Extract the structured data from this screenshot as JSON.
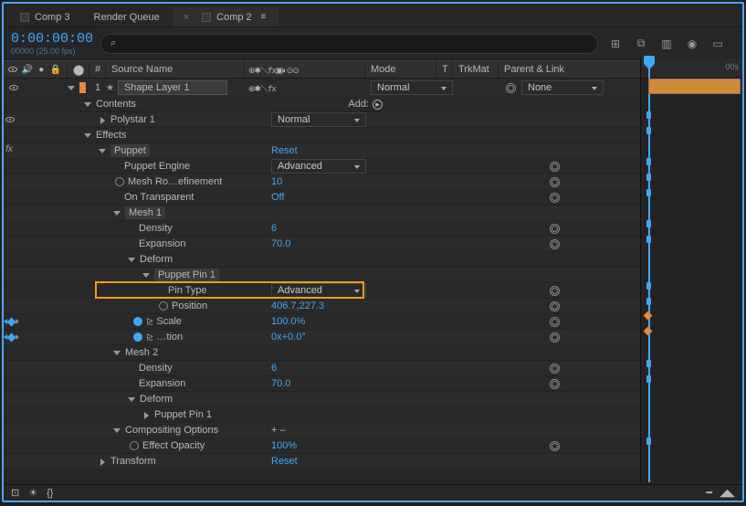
{
  "tabs": {
    "comp3": "Comp 3",
    "renderQueue": "Render Queue",
    "comp2": "Comp 2"
  },
  "time": {
    "code": "0:00:00:00",
    "fps": "00000 (25.00 fps)"
  },
  "search": {
    "placeholder": "⌕"
  },
  "ruler": {
    "start": "00s"
  },
  "header": {
    "hash": "#",
    "sourceName": "Source Name",
    "switches": "⊕✱＼fx▣◐⊙⊙",
    "mode": "Mode",
    "t": "T",
    "trkMat": "TrkMat",
    "parent": "Parent & Link"
  },
  "layer": {
    "index": "1",
    "name": "Shape Layer 1",
    "switches": "⊕✱＼fx",
    "mode": "Normal",
    "parent": "None"
  },
  "tree": {
    "contents": "Contents",
    "add": "Add:",
    "polystar": "Polystar 1",
    "polystarMode": "Normal",
    "effects": "Effects",
    "puppet": "Puppet",
    "reset": "Reset",
    "puppetEngine": "Puppet Engine",
    "engineVal": "Advanced",
    "meshRo": "Mesh Ro…efinement",
    "meshRoVal": "10",
    "onTrans": "On Transparent",
    "onTransVal": "Off",
    "mesh1": "Mesh 1",
    "density": "Density",
    "densityVal": "6",
    "expansion": "Expansion",
    "expansionVal": "70.0",
    "deform": "Deform",
    "pin1": "Puppet Pin 1",
    "pinType": "Pin Type",
    "pinTypeVal": "Advanced",
    "position": "Position",
    "positionVal": "406.7,227.3",
    "scale": "Scale",
    "scaleVal": "100.0%",
    "rotation": "…tion",
    "rotationVal": "0x+0.0°",
    "mesh2": "Mesh 2",
    "density2": "Density",
    "density2Val": "6",
    "expansion2": "Expansion",
    "expansion2Val": "70.0",
    "deform2": "Deform",
    "pin2": "Puppet Pin 1",
    "compOpt": "Compositing Options",
    "plusminus": "+ –",
    "effOpacity": "Effect Opacity",
    "effOpacityVal": "100%",
    "transform": "Transform",
    "transformReset": "Reset"
  },
  "toolbar": {
    "i1": "⊞",
    "i2": "⧉",
    "i3": "▥",
    "i4": "◉",
    "i5": "▭"
  },
  "footer": {
    "i1": "⊡",
    "i2": "☀",
    "i3": "{}",
    "r1": "━",
    "r2": "◢◣"
  }
}
